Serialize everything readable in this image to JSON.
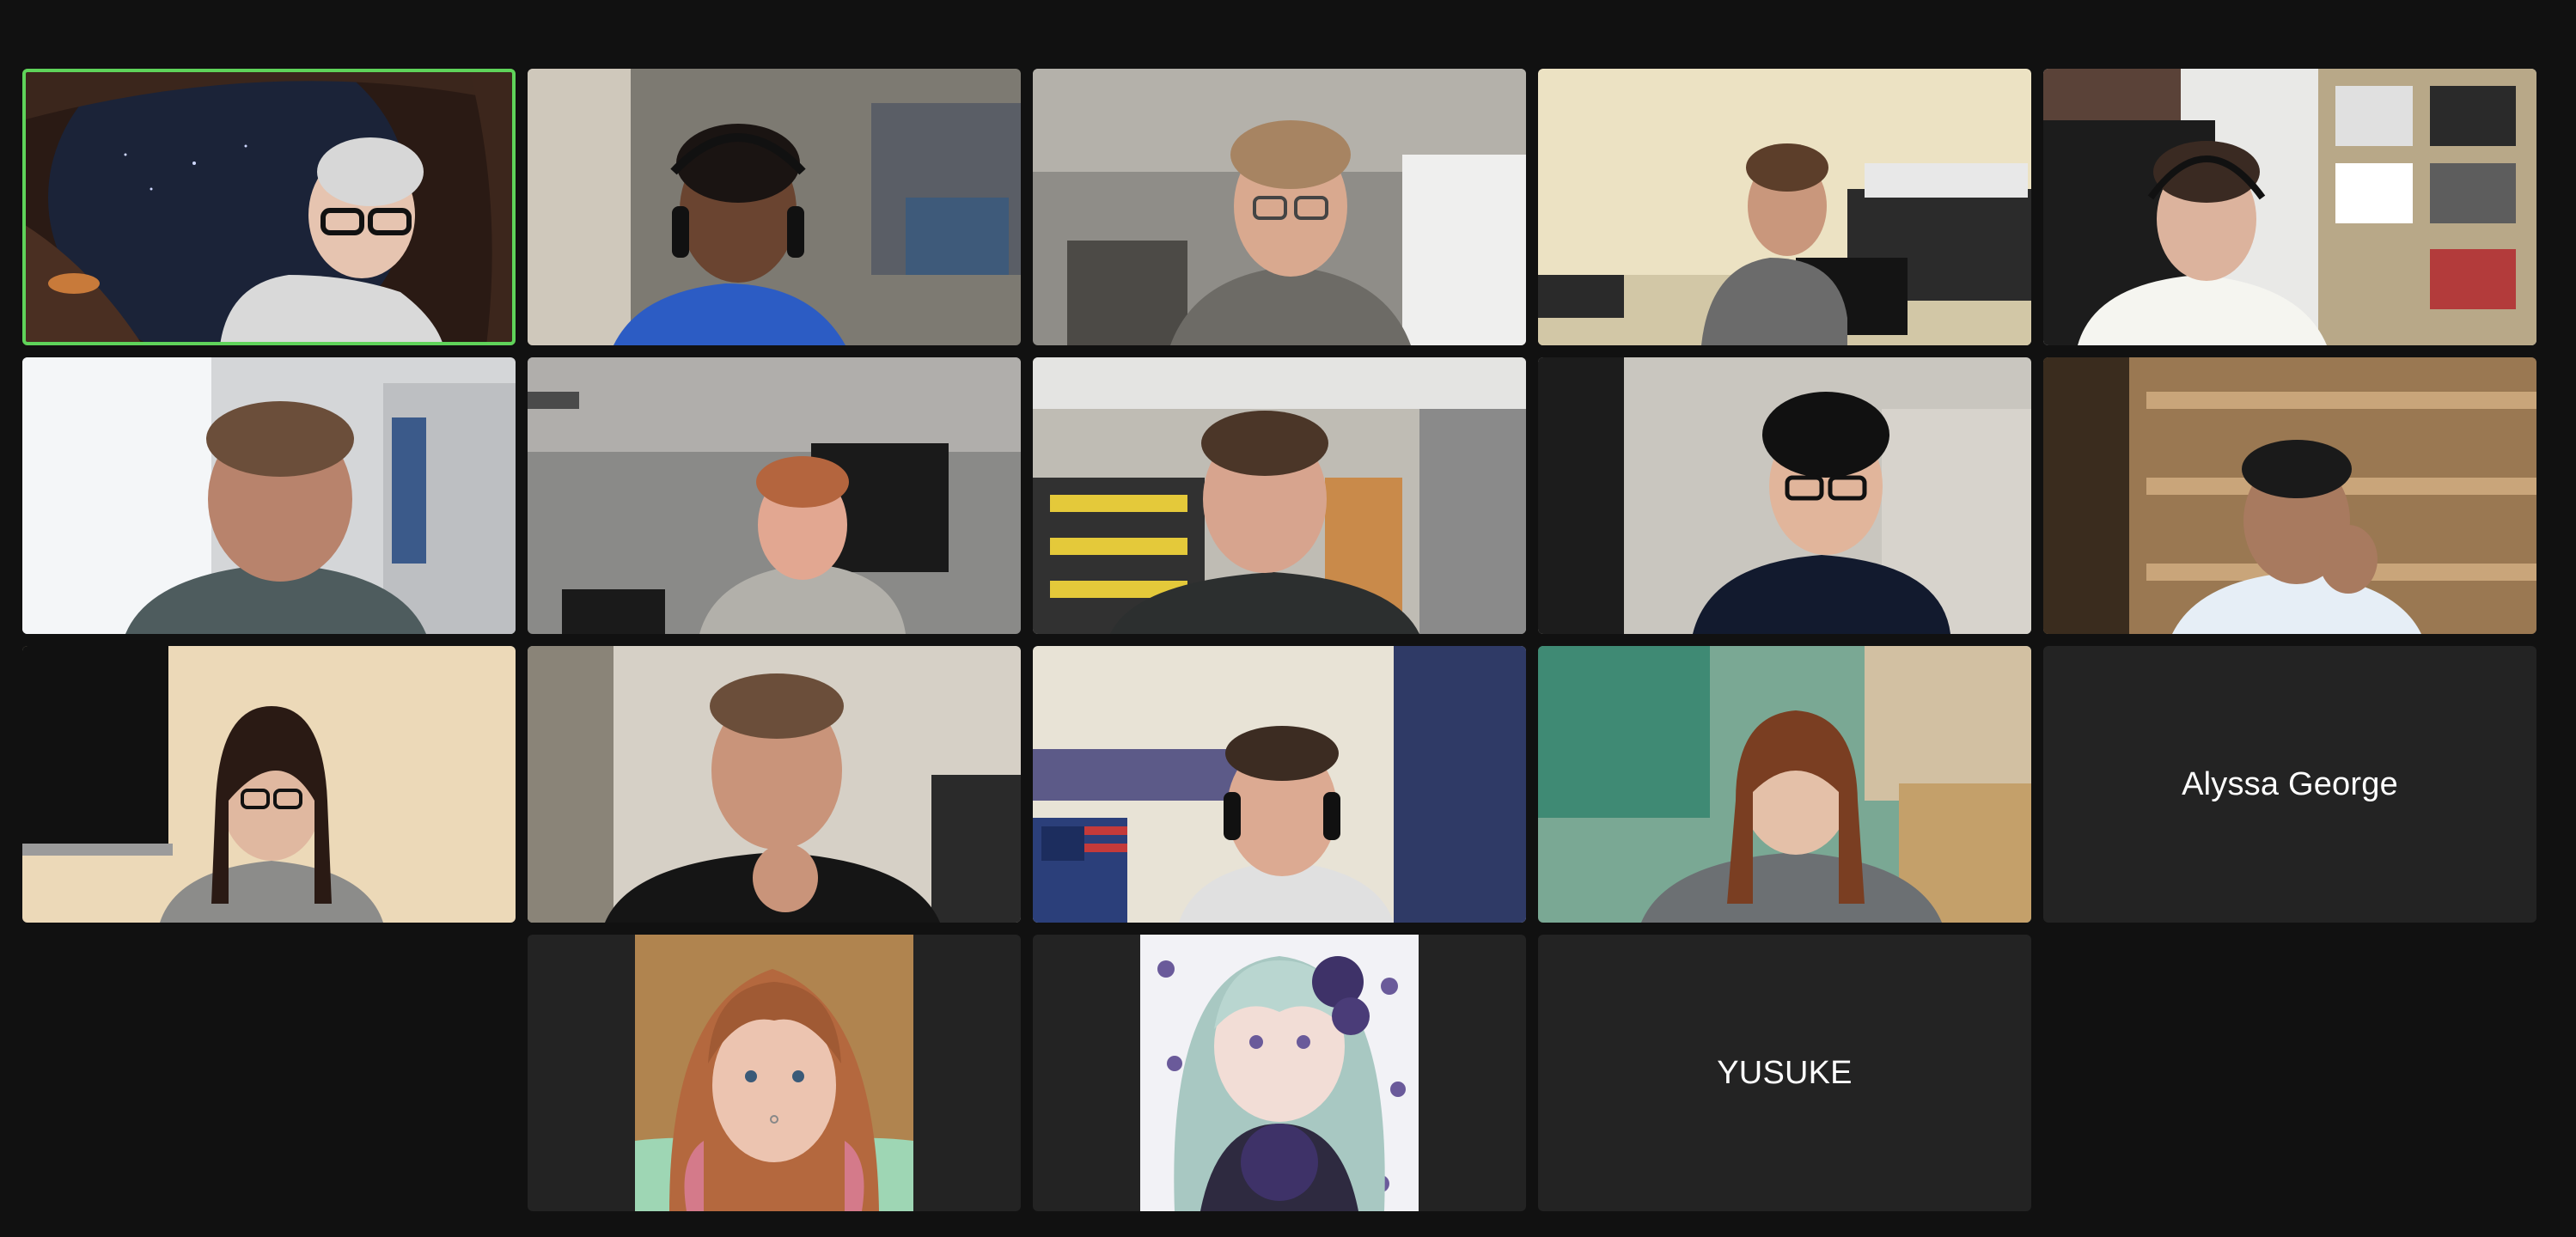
{
  "meeting": {
    "view": "gallery",
    "active_speaker_tile": 0,
    "accent_color": "#5fd35a",
    "background_color": "#111111",
    "tile_color": "#232323"
  },
  "participants": [
    {
      "kind": "video",
      "scene": "night-sky-arch",
      "label": "man with glasses, gray hair"
    },
    {
      "kind": "video",
      "scene": "blurred-office",
      "label": "man with headphones, blue shirt"
    },
    {
      "kind": "video",
      "scene": "blurred-office",
      "label": "young man with glasses"
    },
    {
      "kind": "video",
      "scene": "office-desk",
      "label": "man working at computer"
    },
    {
      "kind": "video",
      "scene": "bookshelf-room",
      "label": "man with headset"
    },
    {
      "kind": "video",
      "scene": "bright-room",
      "label": "man close-up"
    },
    {
      "kind": "video",
      "scene": "classroom-ceiling",
      "label": "man in empty room"
    },
    {
      "kind": "video",
      "scene": "lab-shelves",
      "label": "man in lab"
    },
    {
      "kind": "video",
      "scene": "blurred-room",
      "label": "man with headphones and glasses"
    },
    {
      "kind": "video",
      "scene": "warehouse-shelves",
      "label": "man resting chin on hand"
    },
    {
      "kind": "video",
      "scene": "beige-wall",
      "label": "woman with glasses"
    },
    {
      "kind": "video",
      "scene": "bright-room",
      "label": "man with hand on chin"
    },
    {
      "kind": "video",
      "scene": "dorm-room",
      "label": "man with headphones"
    },
    {
      "kind": "video",
      "scene": "blurred-green",
      "label": "woman with red hair"
    },
    {
      "kind": "name",
      "name": "Alyssa George"
    },
    {
      "kind": "avatar",
      "avatar": "curly-hair-photo"
    },
    {
      "kind": "avatar",
      "avatar": "anime-illustration"
    },
    {
      "kind": "name",
      "name": "YUSUKE"
    }
  ]
}
